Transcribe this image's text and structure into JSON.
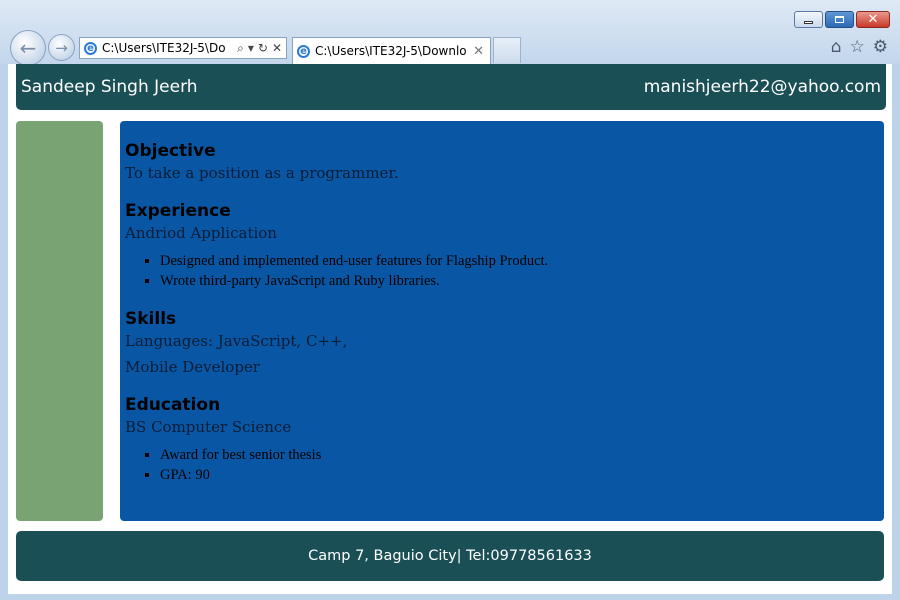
{
  "browser": {
    "address_text": "C:\\Users\\ITE32J-5\\Do",
    "tab_title": "C:\\Users\\ITE32J-5\\Downloa...",
    "icons": [
      "back-icon",
      "forward-icon",
      "search-icon",
      "dropdown-icon",
      "refresh-icon",
      "stop-icon",
      "home-icon",
      "favorites-icon",
      "tools-icon"
    ]
  },
  "header": {
    "name": "Sandeep Singh Jeerh",
    "email": "manishjeerh22@yahoo.com"
  },
  "objective": {
    "title": "Objective",
    "text": "To take a position as a programmer."
  },
  "experience": {
    "title": "Experience",
    "role": "Andriod Application",
    "bullets": [
      "Designed and implemented end-user features for Flagship Product.",
      "Wrote third-party JavaScript and Ruby libraries."
    ]
  },
  "skills": {
    "title": "Skills",
    "languages": "Languages: JavaScript, C++,",
    "other": "Mobile Developer"
  },
  "education": {
    "title": "Education",
    "degree": "BS Computer Science",
    "bullets": [
      "Award for best senior thesis",
      "GPA: 90"
    ]
  },
  "footer": {
    "text": "Camp 7, Baguio City| Tel:09778561633"
  },
  "colors": {
    "header_bg": "#1a4f55",
    "sidebar_bg": "#7aa374",
    "main_bg": "#0957a4"
  }
}
